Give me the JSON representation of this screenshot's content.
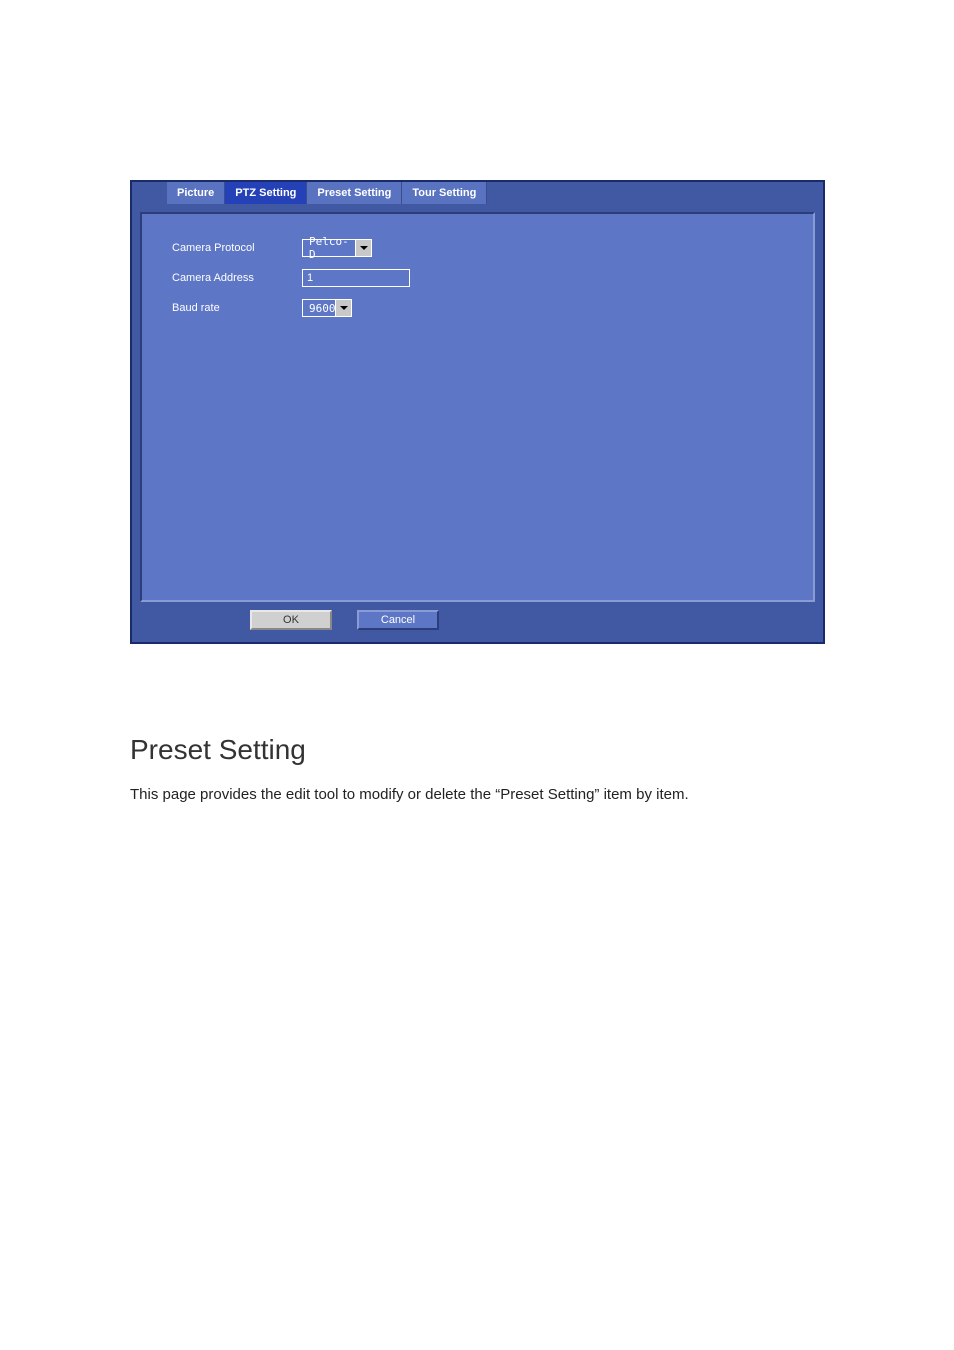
{
  "dialog": {
    "tabs": {
      "picture": "Picture",
      "ptz": "PTZ Setting",
      "preset": "Preset Setting",
      "tour": "Tour Setting"
    },
    "form": {
      "protocol_label": "Camera Protocol",
      "protocol_value": "Pelco-D",
      "address_label": "Camera Address",
      "address_value": "1",
      "baud_label": "Baud rate",
      "baud_value": "9600"
    },
    "buttons": {
      "ok": "OK",
      "cancel": "Cancel"
    }
  },
  "section": {
    "heading": "Preset Setting",
    "body": "This page provides the edit tool to modify or delete the “Preset Setting” item by item."
  }
}
